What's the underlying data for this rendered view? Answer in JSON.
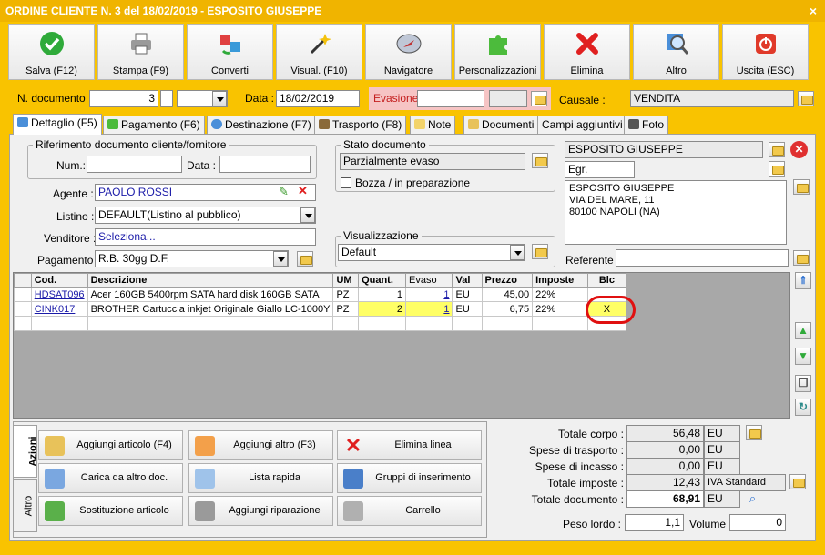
{
  "window": {
    "title": "ORDINE CLIENTE N. 3 del 18/02/2019 - ESPOSITO GIUSEPPE",
    "close": "×"
  },
  "toolbar": [
    {
      "label": "Salva (F12)",
      "icon": "check-icon"
    },
    {
      "label": "Stampa (F9)",
      "icon": "printer-icon"
    },
    {
      "label": "Converti",
      "icon": "convert-icon"
    },
    {
      "label": "Visual. (F10)",
      "icon": "magic-wand-icon"
    },
    {
      "label": "Navigatore",
      "icon": "compass-icon"
    },
    {
      "label": "Personalizzazioni",
      "icon": "puzzle-icon"
    },
    {
      "label": "Elimina",
      "icon": "delete-x-icon"
    },
    {
      "label": "Altro",
      "icon": "magnifier-icon"
    },
    {
      "label": "Uscita (ESC)",
      "icon": "exit-icon"
    }
  ],
  "header": {
    "ndoc_label": "N. documento :",
    "ndoc_value": "3",
    "data_label": "Data :",
    "data_value": "18/02/2019",
    "evasione_label": "Evasione:",
    "evasione_value": "",
    "causale_label": "Causale :",
    "causale_value": "VENDITA"
  },
  "tabs": [
    "Dettaglio (F5)",
    "Pagamento (F6)",
    "Destinazione (F7)",
    "Trasporto (F8)",
    "Note",
    "Documenti",
    "Campi aggiuntivi",
    "Foto"
  ],
  "rif": {
    "title": "Riferimento documento cliente/fornitore",
    "num_label": "Num.:",
    "num_value": "",
    "data_label": "Data :",
    "data_value": ""
  },
  "fields": {
    "agente_label": "Agente :",
    "agente_value": "PAOLO ROSSI",
    "listino_label": "Listino :",
    "listino_value": "DEFAULT(Listino al pubblico)",
    "venditore_label": "Venditore :",
    "venditore_value": "Seleziona...",
    "pagamento_label": "Pagamento :",
    "pagamento_value": "R.B. 30gg D.F."
  },
  "stato": {
    "title": "Stato documento",
    "value": "Parzialmente evaso",
    "bozza_label": "Bozza / in preparazione"
  },
  "visual": {
    "title": "Visualizzazione",
    "value": "Default"
  },
  "cliente": {
    "name": "ESPOSITO GIUSEPPE",
    "title_field": "Egr.",
    "address": [
      "ESPOSITO GIUSEPPE",
      "VIA DEL MARE, 11",
      "80100 NAPOLI (NA)"
    ],
    "referente_label": "Referente",
    "referente_value": ""
  },
  "grid": {
    "headers": [
      "Cod.",
      "Descrizione",
      "UM",
      "Quant.",
      "Evaso",
      "Val",
      "Prezzo",
      "Imposte",
      "Blc"
    ],
    "rows": [
      {
        "cod": "HDSAT096",
        "descr": "Acer 160GB 5400rpm SATA hard disk 160GB SATA",
        "um": "PZ",
        "quant": "1",
        "evaso": "1",
        "val": "EU",
        "prezzo": "45,00",
        "imposte": "22%",
        "blc": ""
      },
      {
        "cod": "CINK017",
        "descr": "BROTHER Cartuccia inkjet Originale Giallo LC-1000Y",
        "um": "PZ",
        "quant": "2",
        "evaso": "1",
        "val": "EU",
        "prezzo": "6,75",
        "imposte": "22%",
        "blc": "X"
      }
    ],
    "highlight_color": "#E01010"
  },
  "actions": {
    "tab_azioni": "Azioni",
    "tab_altro": "Altro",
    "buttons": [
      "Aggiungi articolo (F4)",
      "Aggiungi altro (F3)",
      "Elimina linea",
      "Carica da altro doc.",
      "Lista rapida",
      "Gruppi di inserimento",
      "Sostituzione articolo",
      "Aggiungi riparazione",
      "Carrello"
    ]
  },
  "totals": {
    "corpo_label": "Totale corpo :",
    "corpo": "56,48",
    "corpo_cur": "EU",
    "trasporto_label": "Spese di trasporto :",
    "trasporto": "0,00",
    "trasporto_cur": "EU",
    "incasso_label": "Spese di incasso :",
    "incasso": "0,00",
    "incasso_cur": "EU",
    "imposte_label": "Totale imposte :",
    "imposte": "12,43",
    "imposte_cur": "IVA Standard",
    "documento_label": "Totale documento :",
    "documento": "68,91",
    "documento_cur": "EU",
    "peso_label": "Peso lordo :",
    "peso": "1,1",
    "volume_label": "Volume :",
    "volume": "0"
  }
}
